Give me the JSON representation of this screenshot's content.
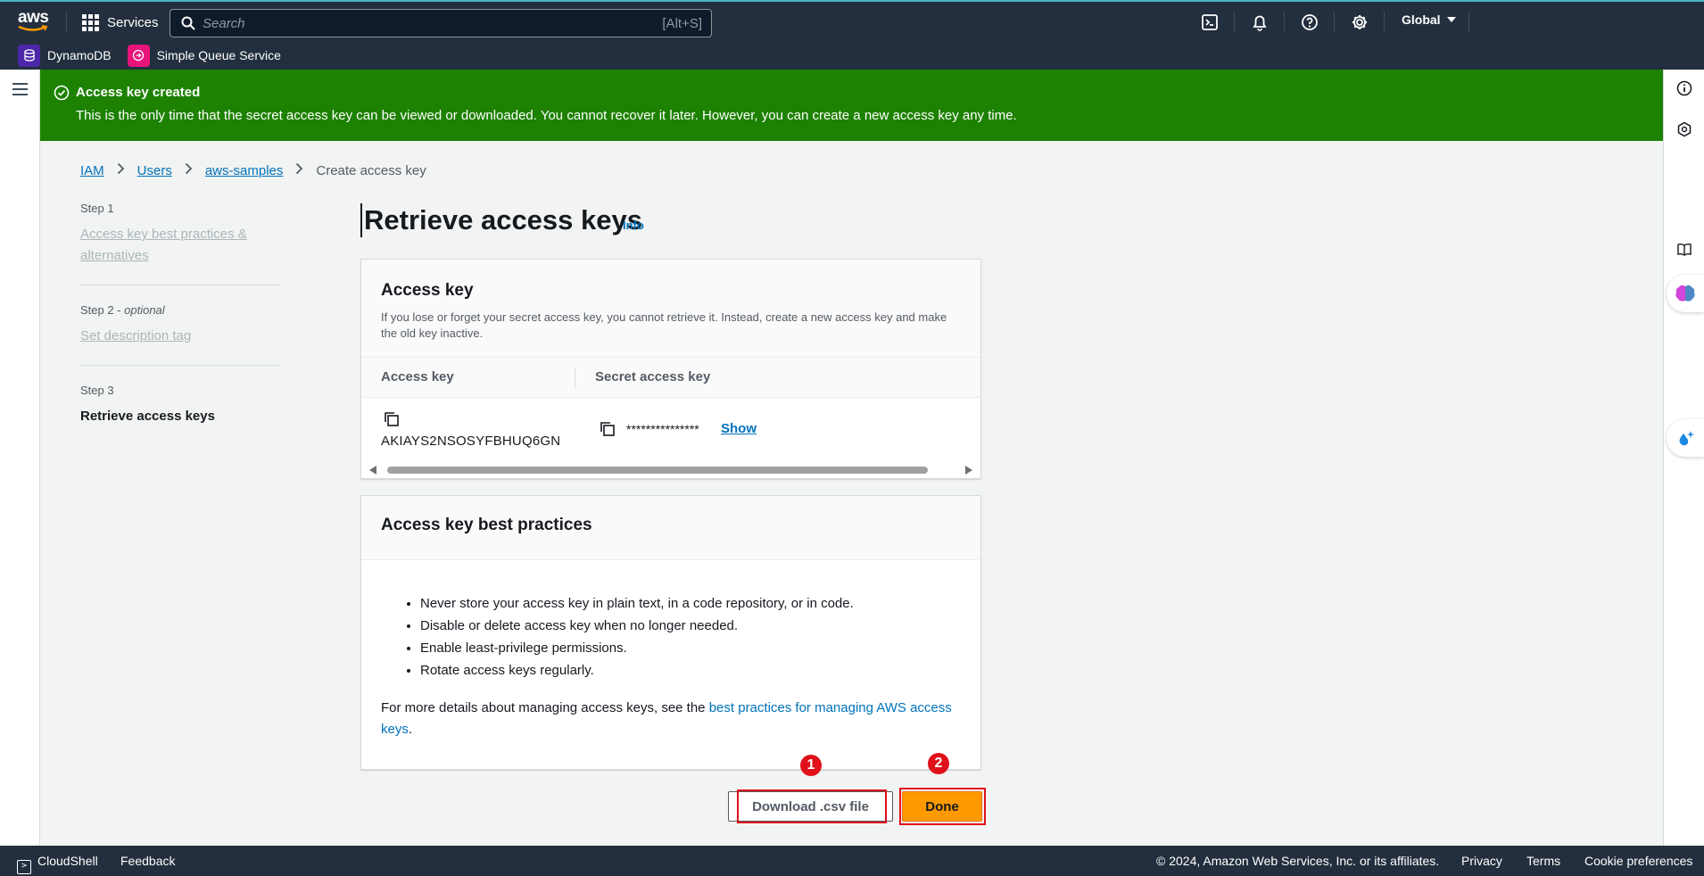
{
  "topnav": {
    "logo": "aws",
    "services_label": "Services",
    "search_placeholder": "Search",
    "search_shortcut": "[Alt+S]",
    "region": "Global"
  },
  "favorites": [
    {
      "label": "DynamoDB",
      "color": "#4d27aa"
    },
    {
      "label": "Simple Queue Service",
      "color": "#e7157b"
    }
  ],
  "flash": {
    "title": "Access key created",
    "message": "This is the only time that the secret access key can be viewed or downloaded. You cannot recover it later. However, you can create a new access key any time.",
    "color": "#1d8102"
  },
  "breadcrumb": {
    "items": [
      "IAM",
      "Users",
      "aws-samples"
    ],
    "current": "Create access key"
  },
  "steps": [
    {
      "num": "Step 1",
      "optional": "",
      "label": "Access key best practices & alternatives"
    },
    {
      "num": "Step 2 - ",
      "optional": "optional",
      "label": "Set description tag"
    },
    {
      "num": "Step 3",
      "optional": "",
      "label": "Retrieve access keys"
    }
  ],
  "page": {
    "title": "Retrieve access keys",
    "info": "Info"
  },
  "access_key_panel": {
    "title": "Access key",
    "description": "If you lose or forget your secret access key, you cannot retrieve it. Instead, create a new access key and make the old key inactive.",
    "col_access_key": "Access key",
    "col_secret": "Secret access key",
    "access_key_id": "AKIAYS2NSOSYFBHUQ6GN",
    "secret_masked": "***************",
    "show_label": "Show"
  },
  "best_practices_panel": {
    "title": "Access key best practices",
    "items": [
      "Never store your access key in plain text, in a code repository, or in code.",
      "Disable or delete access key when no longer needed.",
      "Enable least-privilege permissions.",
      "Rotate access keys regularly."
    ],
    "more_prefix": "For more details about managing access keys, see the ",
    "more_link": "best practices for managing AWS access keys",
    "more_suffix": "."
  },
  "buttons": {
    "download": "Download .csv file",
    "done": "Done"
  },
  "annotations": [
    "1",
    "2"
  ],
  "footer": {
    "cloudshell": "CloudShell",
    "feedback": "Feedback",
    "copyright": "© 2024, Amazon Web Services, Inc. or its affiliates.",
    "privacy": "Privacy",
    "terms": "Terms",
    "cookies": "Cookie preferences"
  },
  "colors": {
    "nav_bg": "#232f3e",
    "link": "#0073bb",
    "primary_button": "#ff9900",
    "highlight": "#e0111b"
  }
}
